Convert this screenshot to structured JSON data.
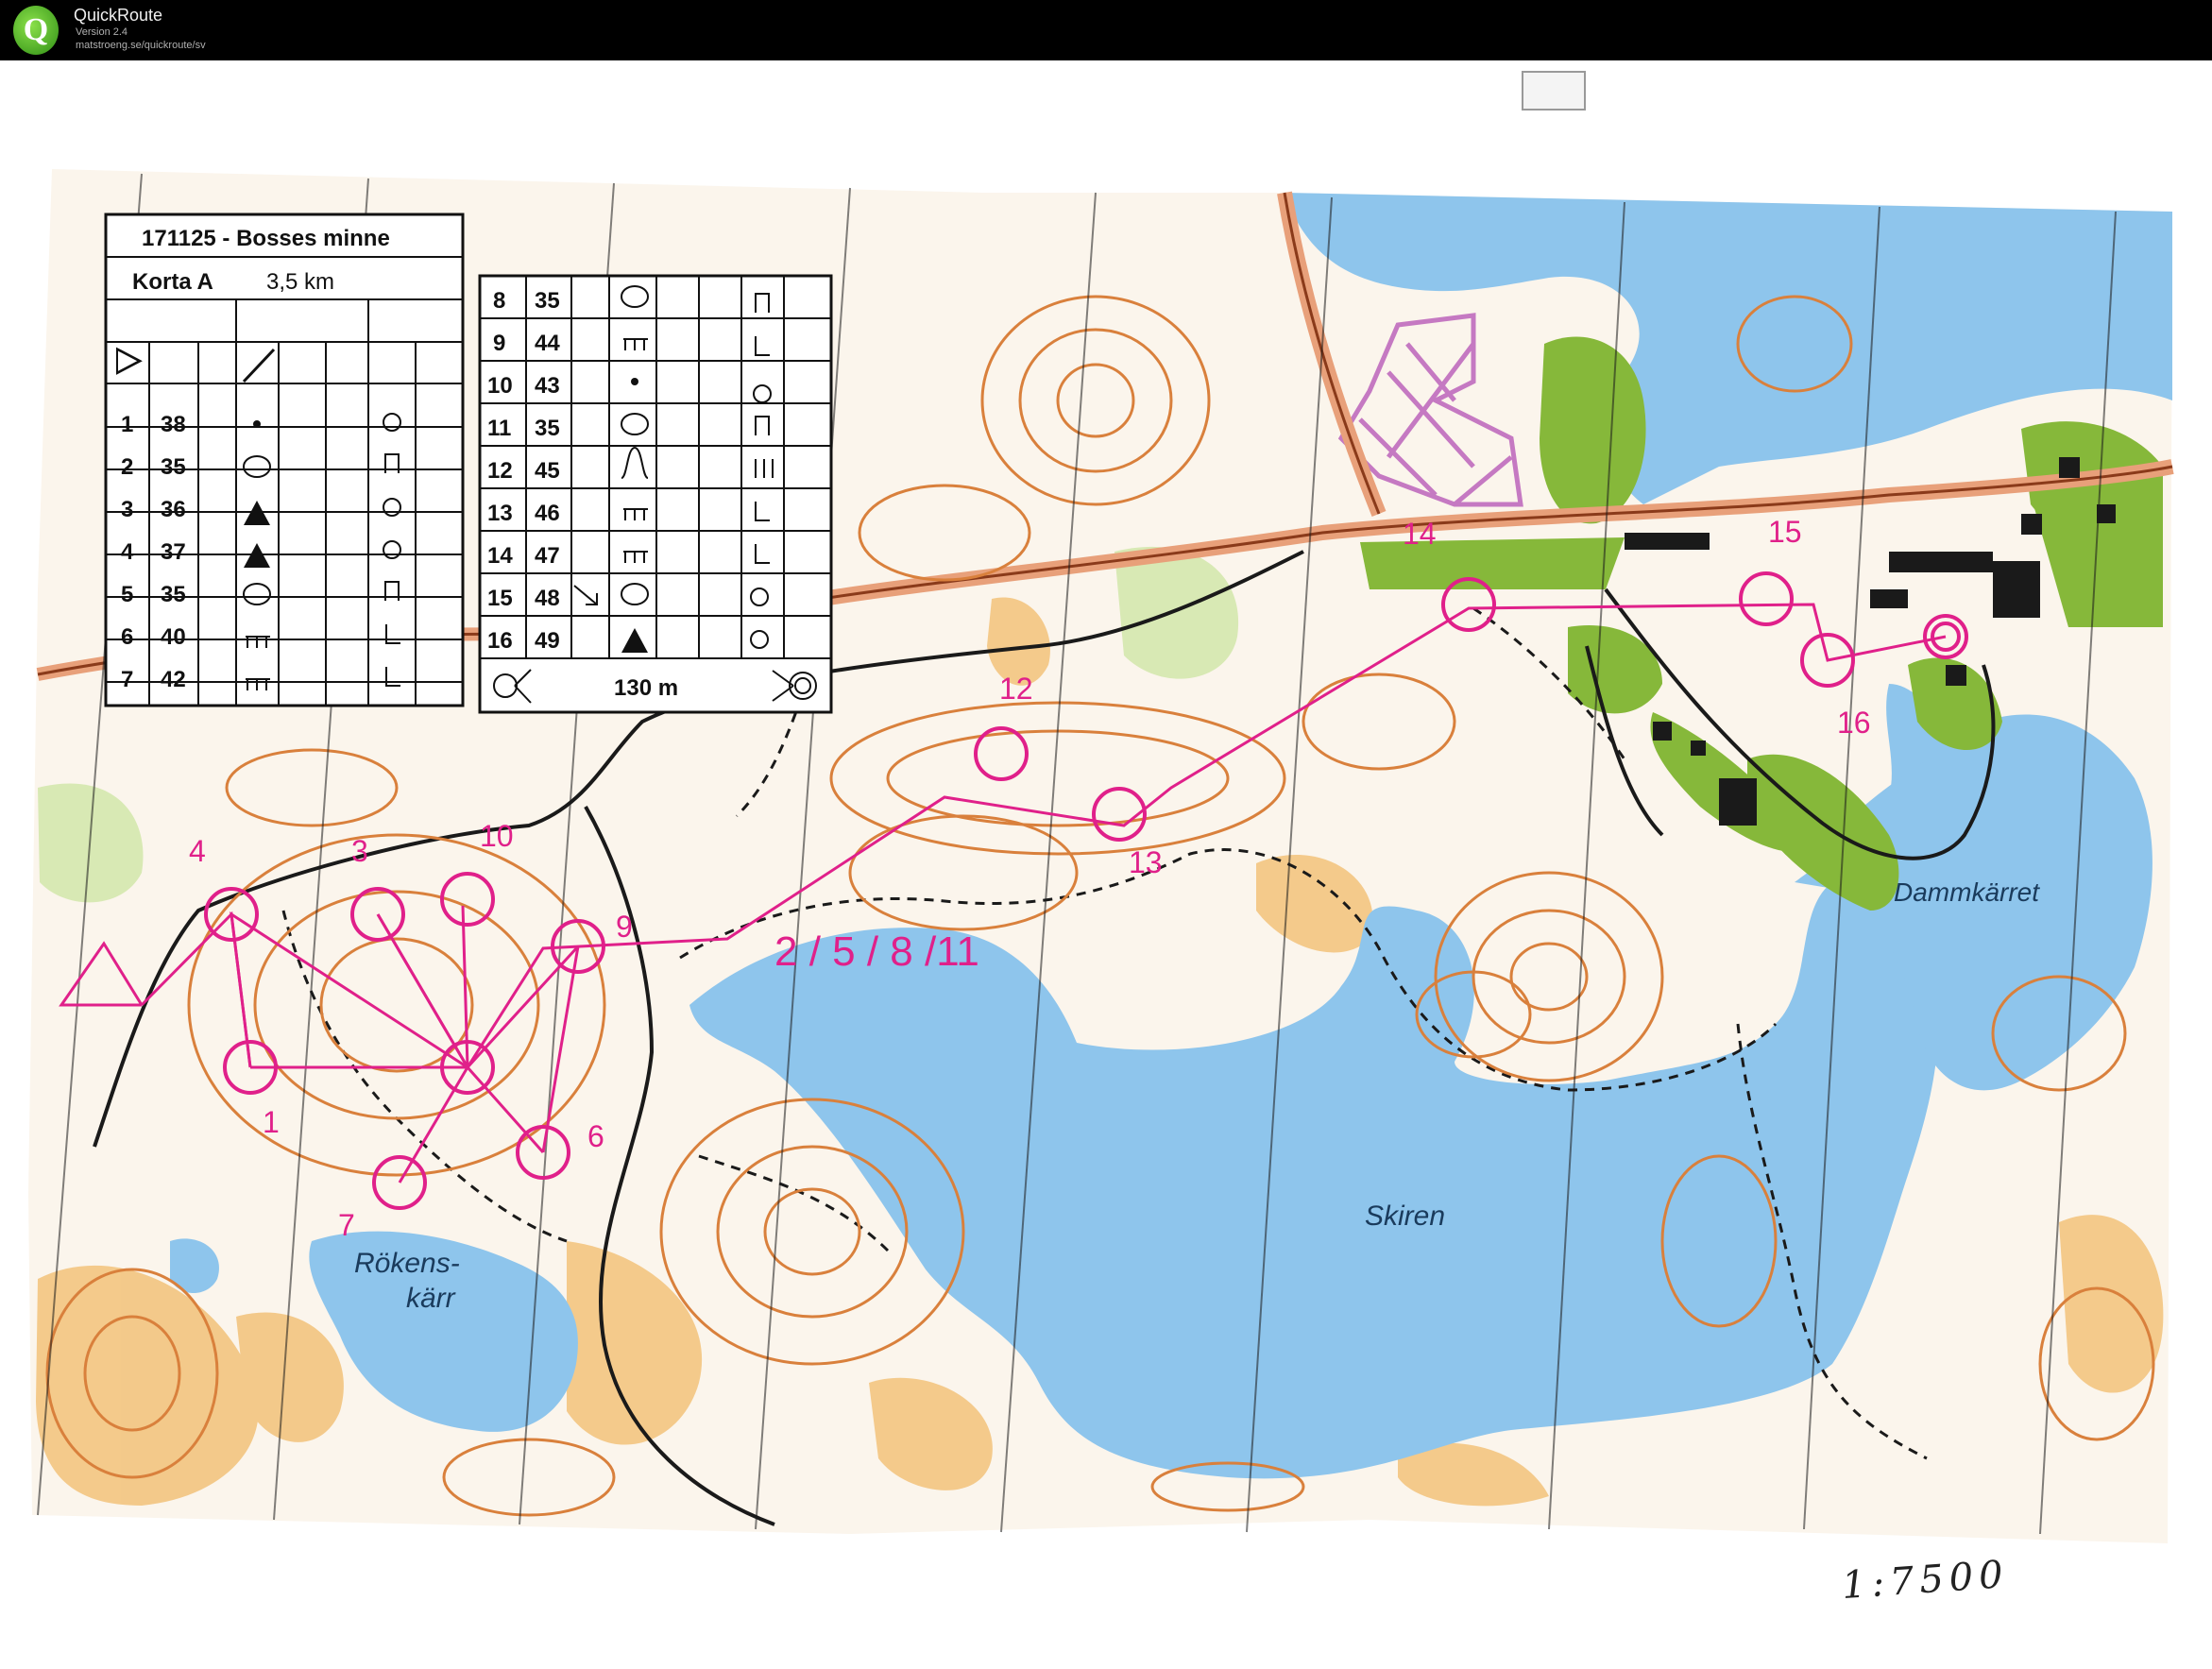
{
  "app": {
    "title": "QuickRoute",
    "version": "Version 2.4",
    "url": "matstroeng.se/quickroute/sv",
    "logo_letter": "Q"
  },
  "legend_left": {
    "title": "171125 - Bosses minne",
    "class": "Korta A",
    "length": "3,5 km",
    "rows": [
      {
        "num": "1",
        "code": "38"
      },
      {
        "num": "2",
        "code": "35"
      },
      {
        "num": "3",
        "code": "36"
      },
      {
        "num": "4",
        "code": "37"
      },
      {
        "num": "5",
        "code": "35"
      },
      {
        "num": "6",
        "code": "40"
      },
      {
        "num": "7",
        "code": "42"
      }
    ]
  },
  "legend_right": {
    "rows": [
      {
        "num": "8",
        "code": "35"
      },
      {
        "num": "9",
        "code": "44"
      },
      {
        "num": "10",
        "code": "43"
      },
      {
        "num": "11",
        "code": "35"
      },
      {
        "num": "12",
        "code": "45"
      },
      {
        "num": "13",
        "code": "46"
      },
      {
        "num": "14",
        "code": "47"
      },
      {
        "num": "15",
        "code": "48"
      },
      {
        "num": "16",
        "code": "49"
      }
    ],
    "finish_distance": "130 m"
  },
  "controls": [
    {
      "label": "1"
    },
    {
      "label": "2 / 5 / 8 /11"
    },
    {
      "label": "3"
    },
    {
      "label": "4"
    },
    {
      "label": "6"
    },
    {
      "label": "7"
    },
    {
      "label": "9"
    },
    {
      "label": "10"
    },
    {
      "label": "12"
    },
    {
      "label": "13"
    },
    {
      "label": "14"
    },
    {
      "label": "15"
    },
    {
      "label": "16"
    }
  ],
  "place_names": {
    "lake_main": "Skiren",
    "lake_left": "Rökens-",
    "lake_left_2": "kärr",
    "lake_right": "Dammkärret"
  },
  "scale_note": "1:7500",
  "colors": {
    "water": "#8ec5ec",
    "course": "#e0208a",
    "contour": "#d9803c",
    "open_land": "#f2c27a",
    "green": "#86b83a",
    "road": "#e8a07a",
    "building": "#1a1a1a"
  }
}
